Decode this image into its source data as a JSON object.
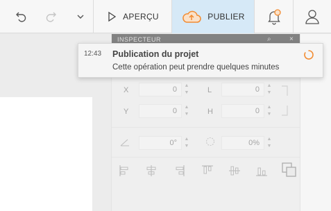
{
  "toolbar": {
    "undo_icon": "undo-icon",
    "redo_icon": "redo-icon",
    "more_icon": "chevron-down-icon",
    "preview_label": "APERÇU",
    "preview_icon": "play-icon",
    "publish_label": "PUBLIER",
    "publish_icon": "cloud-upload-icon",
    "notifications_icon": "bell-icon",
    "profile_icon": "user-icon",
    "accent_color": "#f28b30",
    "publish_bg": "#d6e9f7"
  },
  "inspector": {
    "title": "INSPECTEUR",
    "fields": {
      "x_label": "X",
      "x_value": "0",
      "y_label": "Y",
      "y_value": "0",
      "l_label": "L",
      "l_value": "0",
      "h_label": "H",
      "h_value": "0",
      "rotation_value": "0°",
      "opacity_value": "0%"
    }
  },
  "notification": {
    "time": "12:43",
    "title": "Publication du projet",
    "message": "Cette opération peut prendre quelques minutes",
    "spinner_color": "#f28b30"
  }
}
